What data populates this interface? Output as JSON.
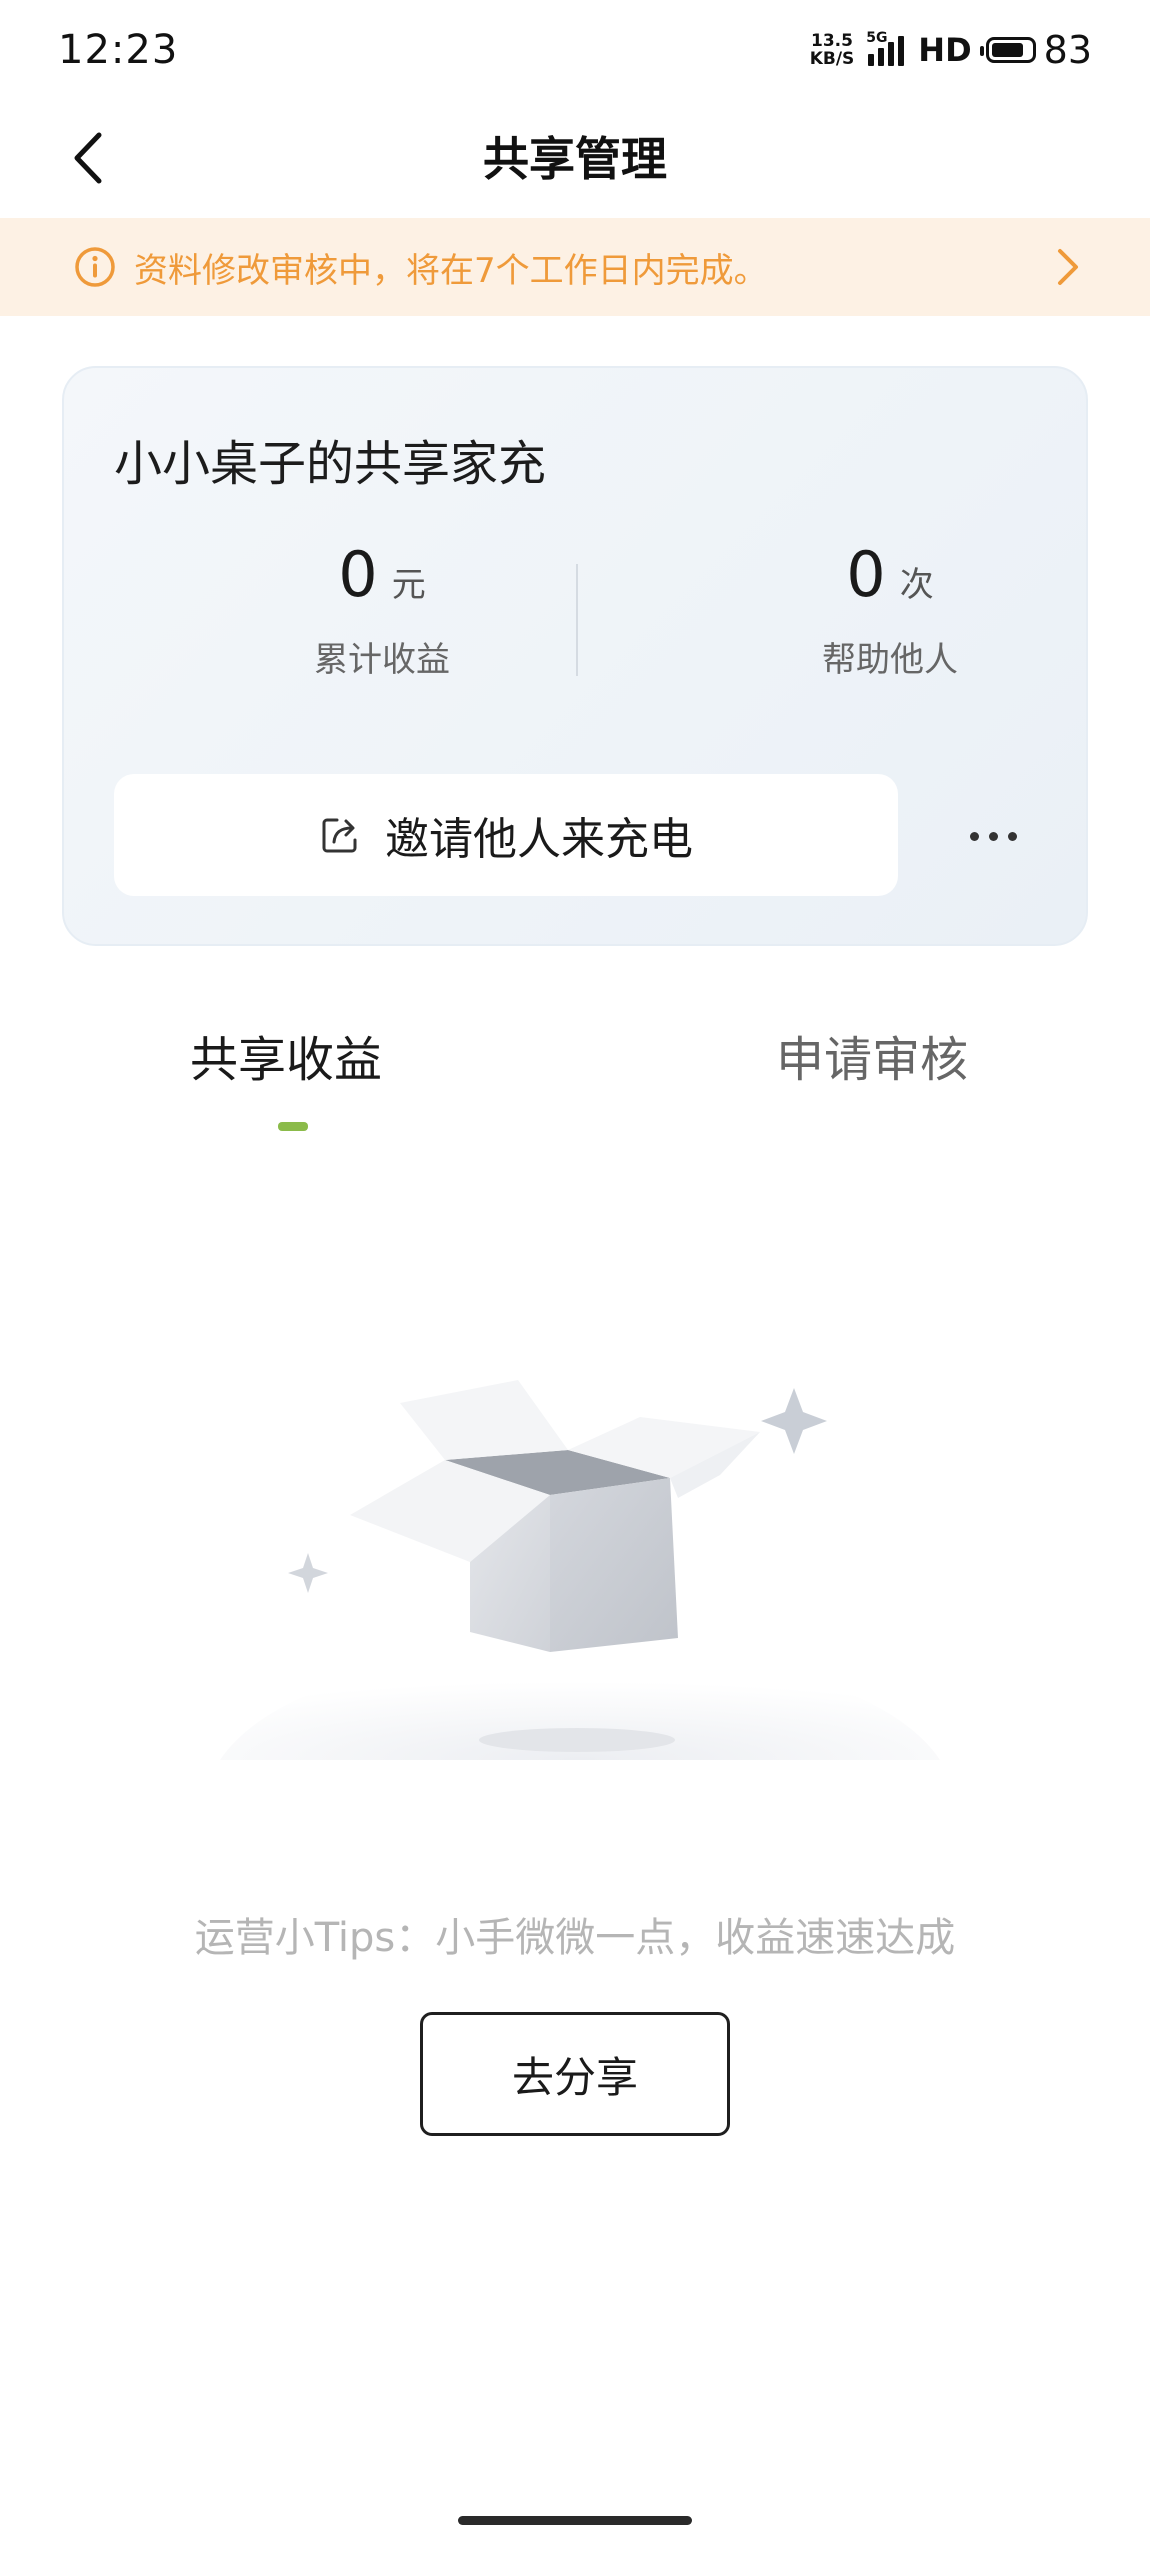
{
  "status_bar": {
    "time": "12:23",
    "net_speed_value": "13.5",
    "net_speed_unit": "KB/S",
    "network_type": "5G",
    "hd_label": "HD",
    "battery_level": "83",
    "battery_fraction": 0.83
  },
  "header": {
    "title": "共享管理",
    "back_icon": "chevron-left-icon"
  },
  "notice": {
    "icon": "info-icon",
    "text": "资料修改审核中，将在7个工作日内完成。",
    "arrow_icon": "chevron-right-icon",
    "color": "#ef9a3a",
    "background": "#fdf1e4"
  },
  "card": {
    "title": "小小桌子的共享家充",
    "stats": [
      {
        "value": "0",
        "unit": "元",
        "label": "累计收益"
      },
      {
        "value": "0",
        "unit": "次",
        "label": "帮助他人"
      }
    ],
    "invite_button": {
      "icon": "share-icon",
      "label": "邀请他人来充电"
    },
    "more_icon": "more-dots-icon"
  },
  "tabs": [
    {
      "label": "共享收益",
      "active": true
    },
    {
      "label": "申请审核",
      "active": false
    }
  ],
  "tab_indicator_color": "#8bbb4a",
  "empty_state": {
    "illustration": "empty-box-illustration",
    "tips": "运营小Tips：小手微微一点，收益速速达成",
    "button_label": "去分享"
  }
}
